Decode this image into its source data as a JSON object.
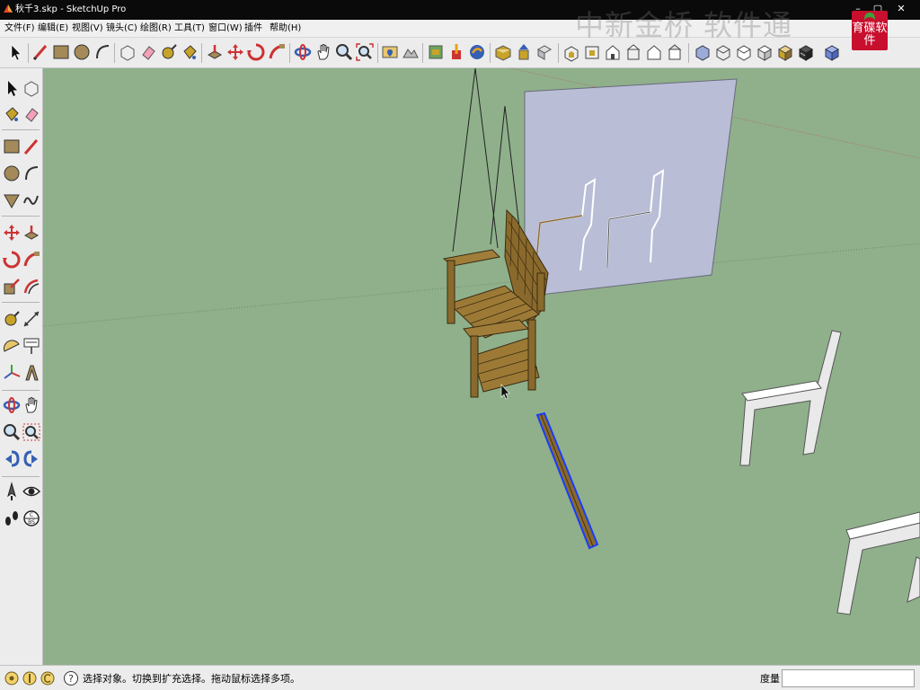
{
  "window": {
    "title": "秋千3.skp - SketchUp Pro",
    "app_icon": "sketchup-app-icon",
    "minimize": "–",
    "maximize": "▢",
    "close": "✕"
  },
  "menu": {
    "items": [
      "文件(F)",
      "编辑(E)",
      "视图(V)",
      "镜头(C)",
      "绘图(R)",
      "工具(T)",
      "窗口(W)",
      "插件",
      "帮助(H)"
    ]
  },
  "watermark": {
    "text": "中新金桥 软件通",
    "logo_text": "育碟软件",
    "logo_color": "#c8102e"
  },
  "toolbar": {
    "icons": [
      "select-icon",
      "pencil-icon",
      "rectangle-icon",
      "circle-icon",
      "arc-icon",
      "eraser-icon",
      "paint-bucket-icon",
      "tape-measure-icon",
      "push-pull-icon",
      "move-icon",
      "rotate-icon",
      "follow-me-icon",
      "orbit-icon",
      "pan-icon",
      "zoom-icon",
      "zoom-extents-icon",
      "add-location-icon",
      "toggle-terrain-icon",
      "photo-textures-icon",
      "get-models-icon",
      "share-model-icon",
      "iso-view-icon",
      "top-view-icon",
      "front-view-icon",
      "right-view-icon",
      "back-view-icon",
      "left-view-icon",
      "xray-icon",
      "wireframe-icon",
      "hidden-line-icon",
      "shaded-icon",
      "shaded-textures-icon",
      "monochrome-icon"
    ]
  },
  "left_toolbar": {
    "icons": [
      "select-icon",
      "make-component-icon",
      "paint-bucket-icon",
      "eraser-icon",
      "rectangle-icon",
      "line-icon",
      "circle-icon",
      "arc-icon",
      "polygon-icon",
      "freehand-icon",
      "move-icon",
      "push-pull-icon",
      "rotate-icon",
      "follow-me-icon",
      "scale-icon",
      "offset-icon",
      "tape-measure-icon",
      "dimension-icon",
      "protractor-icon",
      "text-icon",
      "axes-icon",
      "3d-text-icon",
      "orbit-icon",
      "pan-icon",
      "zoom-icon",
      "zoom-window-icon",
      "previous-view-icon",
      "next-view-icon",
      "position-camera-icon",
      "look-around-icon",
      "walk-icon",
      "section-plane-icon"
    ]
  },
  "status": {
    "icons": [
      "geo-location-icon",
      "credits-icon",
      "copyright-icon",
      "help-icon"
    ],
    "hint": "选择对象。切换到扩充选择。拖动鼠标选择多项。",
    "measure_label": "度量",
    "measure_value": ""
  },
  "scene": {
    "background": "#8fb08b",
    "objects": [
      "swing-chair",
      "chair-plane-sketch",
      "selected-plank",
      "chair-frame-profile-1",
      "chair-frame-profile-2"
    ],
    "plane_color": "#b9bdd6",
    "wood_color": "#8a6a2c",
    "selection_color": "#1a3cff"
  }
}
